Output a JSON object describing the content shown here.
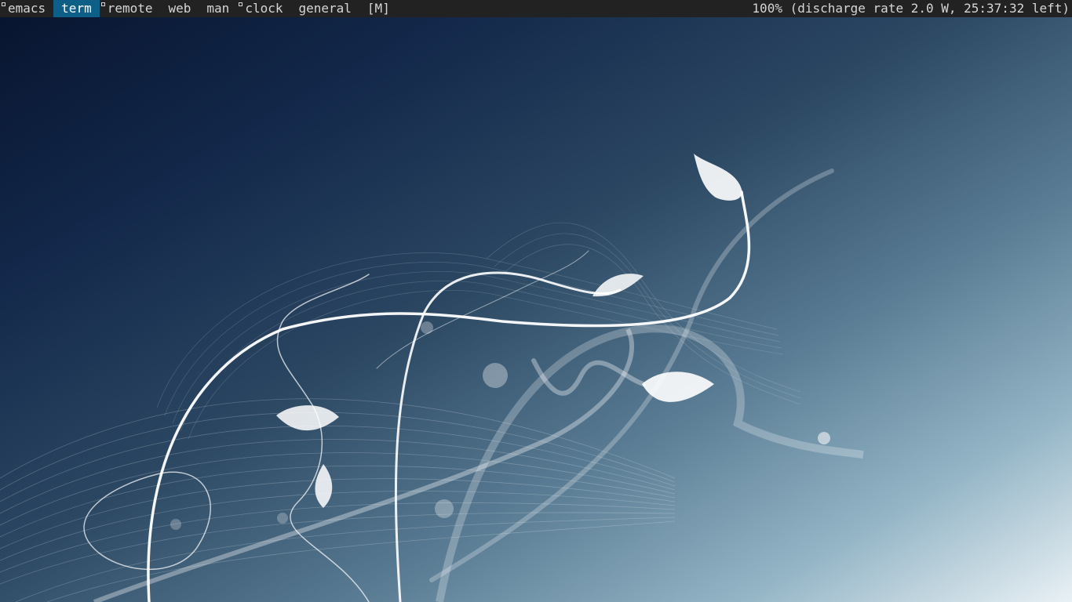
{
  "taglist": {
    "tags": [
      {
        "label": "emacs",
        "occupied": true,
        "selected": false
      },
      {
        "label": "term",
        "occupied": false,
        "selected": true
      },
      {
        "label": "remote",
        "occupied": true,
        "selected": false
      },
      {
        "label": "web",
        "occupied": false,
        "selected": false
      },
      {
        "label": "man",
        "occupied": false,
        "selected": false
      },
      {
        "label": "clock",
        "occupied": true,
        "selected": false
      },
      {
        "label": "general",
        "occupied": false,
        "selected": false
      }
    ],
    "layout": "[M]"
  },
  "status": {
    "battery": "100% (discharge rate 2.0 W, 25:37:32 left)"
  }
}
